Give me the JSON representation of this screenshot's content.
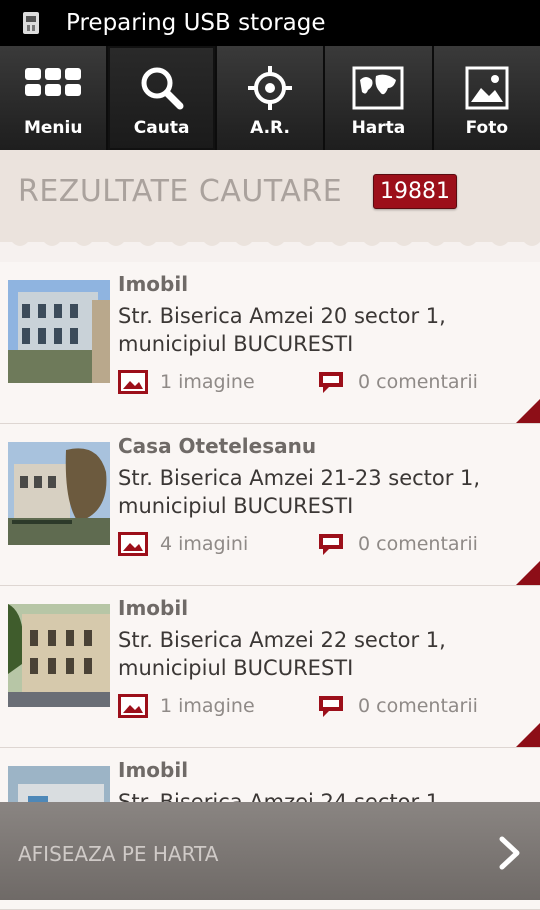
{
  "status_bar": {
    "text": "Preparing USB storage",
    "icon": "usb-icon"
  },
  "tabs": [
    {
      "label": "Meniu",
      "icon": "grid-icon",
      "active": false
    },
    {
      "label": "Cauta",
      "icon": "search-icon",
      "active": true
    },
    {
      "label": "A.R.",
      "icon": "target-icon",
      "active": false
    },
    {
      "label": "Harta",
      "icon": "map-icon",
      "active": false
    },
    {
      "label": "Foto",
      "icon": "photo-icon",
      "active": false
    }
  ],
  "header": {
    "title": "REZULTATE CAUTARE",
    "count": "19881"
  },
  "results": [
    {
      "name": "Imobil",
      "address": "Str. Biserica Amzei 20 sector 1, municipiul BUCURESTI",
      "images": "1 imagine",
      "comments": "0 comentarii"
    },
    {
      "name": "Casa Otetelesanu",
      "address": "Str. Biserica Amzei 21-23 sector 1, municipiul BUCURESTI",
      "images": "4 imagini",
      "comments": "0 comentarii"
    },
    {
      "name": "Imobil",
      "address": "Str. Biserica Amzei 22 sector 1, municipiul BUCURESTI",
      "images": "1 imagine",
      "comments": "0 comentarii"
    },
    {
      "name": "Imobil",
      "address": "Str. Biserica Amzei 24 sector 1,",
      "images": "",
      "comments": ""
    }
  ],
  "bottom_bar": {
    "label": "AFISEAZA PE HARTA",
    "icon": "chevron-right-icon"
  },
  "colors": {
    "accent": "#9c0f1a",
    "background": "#f6f1ef",
    "tabbar": "#2a2a2a"
  }
}
